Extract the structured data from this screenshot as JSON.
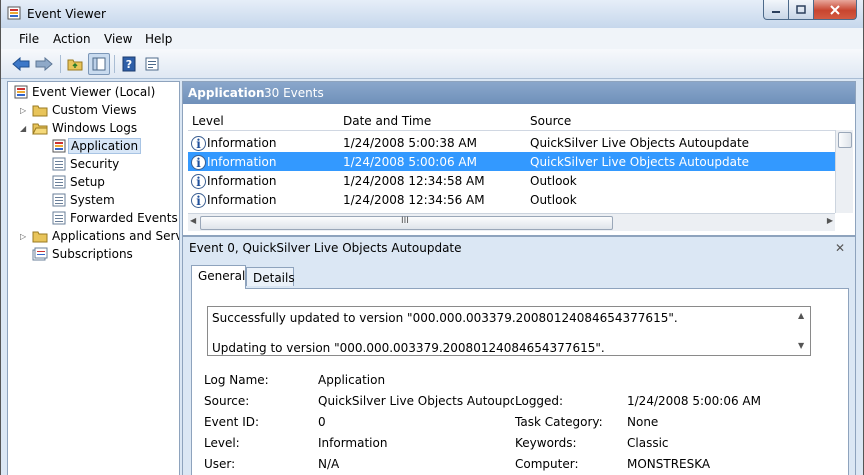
{
  "window": {
    "title": "Event Viewer",
    "buttons": {
      "minimize": "–",
      "maximize": "□",
      "close": "✕"
    }
  },
  "menu": [
    "File",
    "Action",
    "View",
    "Help"
  ],
  "toolbar": [
    "back",
    "forward",
    "up-folder",
    "show-hide-tree",
    "help",
    "properties"
  ],
  "tree": {
    "root": "Event Viewer (Local)",
    "custom_views": "Custom Views",
    "windows_logs": "Windows Logs",
    "logs": [
      "Application",
      "Security",
      "Setup",
      "System",
      "Forwarded Events"
    ],
    "apps_services": "Applications and Servic",
    "subscriptions": "Subscriptions"
  },
  "list_pane": {
    "header_title": "Application",
    "header_count": "30 Events",
    "columns": [
      "Level",
      "Date and Time",
      "Source"
    ],
    "rows": [
      {
        "level": "Information",
        "datetime": "1/24/2008 5:00:38 AM",
        "source": "QuickSilver Live Objects Autoupdate"
      },
      {
        "level": "Information",
        "datetime": "1/24/2008 5:00:06 AM",
        "source": "QuickSilver Live Objects Autoupdate"
      },
      {
        "level": "Information",
        "datetime": "1/24/2008 12:34:58 AM",
        "source": "Outlook"
      },
      {
        "level": "Information",
        "datetime": "1/24/2008 12:34:56 AM",
        "source": "Outlook"
      }
    ],
    "selected_row": 1,
    "hscroll_grip": "III"
  },
  "detail": {
    "title": "Event 0, QuickSilver Live Objects Autoupdate",
    "close": "✕",
    "tabs": [
      "General",
      "Details"
    ],
    "message": [
      "Successfully updated to version \"000.000.003379.20080124084654377615\".",
      "Updating to version \"000.000.003379.20080124084654377615\"."
    ],
    "props": {
      "log_name_label": "Log Name:",
      "log_name": "Application",
      "source_label": "Source:",
      "source": "QuickSilver Live Objects Autoupdate",
      "logged_label": "Logged:",
      "logged": "1/24/2008 5:00:06 AM",
      "event_id_label": "Event ID:",
      "event_id": "0",
      "task_label": "Task Category:",
      "task": "None",
      "level_label": "Level:",
      "level": "Information",
      "keywords_label": "Keywords:",
      "keywords": "Classic",
      "user_label": "User:",
      "user": "N/A",
      "computer_label": "Computer:",
      "computer": "MONSTRESKA"
    }
  },
  "colors": {
    "selection": "#3399ff",
    "pane_header": "#7796bf",
    "window_bg": "#dbe7f4"
  }
}
